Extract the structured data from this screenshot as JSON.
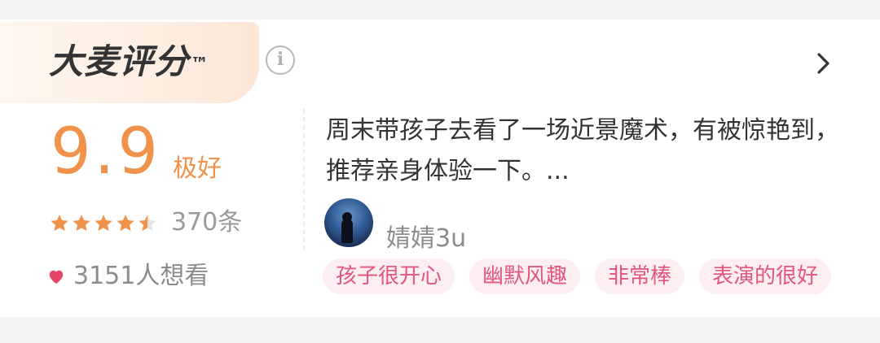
{
  "brand": {
    "title": "大麦评分",
    "tm": "™"
  },
  "rating": {
    "score": "9.9",
    "label": "极好",
    "stars": 4.5,
    "count": "370条",
    "want": "3151人想看"
  },
  "review": {
    "text": "周末带孩子去看了一场近景魔术，有被惊艳到，推荐亲身体验一下。...",
    "user": "婧婧3u"
  },
  "tags": [
    "孩子很开心",
    "幽默风趣",
    "非常棒",
    "表演的很好"
  ],
  "colors": {
    "accent": "#f0924a",
    "tag_bg": "#fdeef2",
    "tag_text": "#e2557e",
    "heart": "#e8456c"
  },
  "icons": {
    "info": "info-circle-icon",
    "chevron": "chevron-right-icon",
    "star": "star-icon",
    "heart": "heart-icon"
  }
}
